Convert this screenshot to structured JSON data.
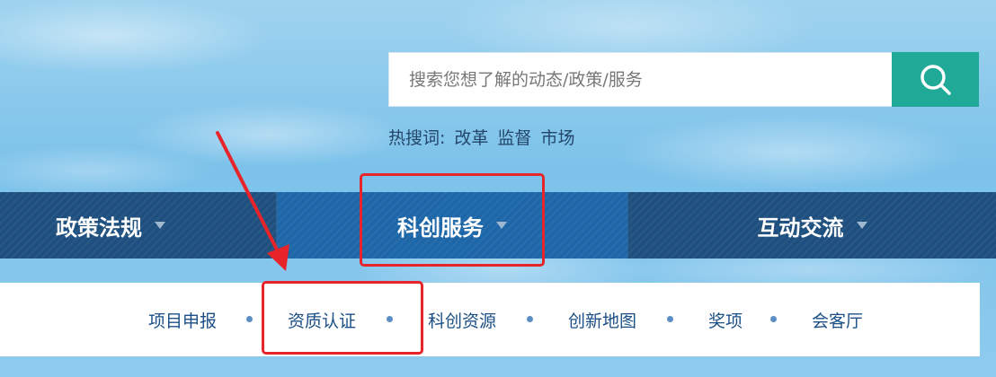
{
  "search": {
    "placeholder": "搜索您想了解的动态/政策/服务",
    "button_icon": "search-icon"
  },
  "hot_words": {
    "label": "热搜词:",
    "items": [
      "改革",
      "监督",
      "市场"
    ]
  },
  "main_nav": {
    "items": [
      {
        "label": "政策法规",
        "active": false
      },
      {
        "label": "科创服务",
        "active": true
      },
      {
        "label": "互动交流",
        "active": false
      }
    ]
  },
  "sub_nav": {
    "items": [
      "项目申报",
      "资质认证",
      "科创资源",
      "创新地图",
      "奖项",
      "会客厅"
    ]
  },
  "colors": {
    "accent_green": "#1fa996",
    "nav_dark": "#1e4f7e",
    "nav_active": "#1d66a8",
    "annotation_red": "#e8242b"
  }
}
